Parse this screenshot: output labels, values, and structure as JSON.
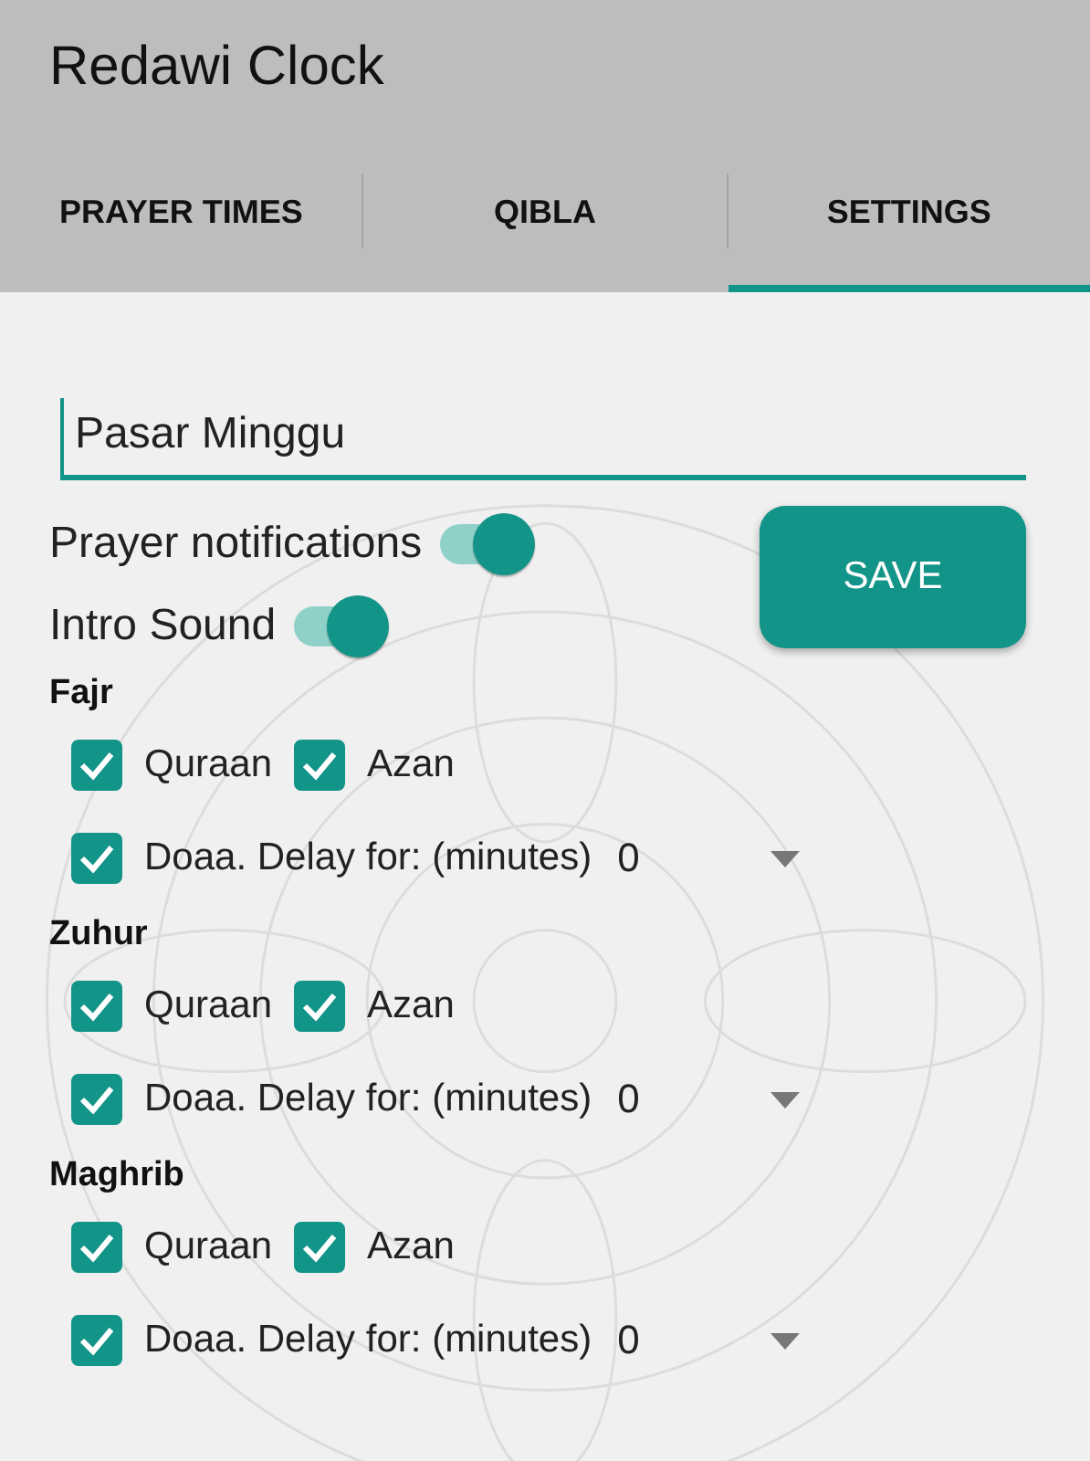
{
  "app_bar": {
    "title": "Redawi Clock"
  },
  "tabs": [
    {
      "label": "PRAYER TIMES",
      "selected": false
    },
    {
      "label": "QIBLA",
      "selected": false
    },
    {
      "label": "SETTINGS",
      "selected": true
    }
  ],
  "city": {
    "value": "Pasar Minggu"
  },
  "toggles": [
    {
      "label": "Prayer notifications",
      "on": true
    },
    {
      "label": "Intro Sound",
      "on": true
    }
  ],
  "save_button": "SAVE",
  "prayers": [
    {
      "name": "Fajr",
      "options": [
        {
          "label": "Quraan",
          "checked": true
        },
        {
          "label": "Azan",
          "checked": true
        }
      ],
      "doaa": {
        "label": "Doaa. Delay for: (minutes)",
        "checked": true
      },
      "delay": "0"
    },
    {
      "name": "Zuhur",
      "options": [
        {
          "label": "Quraan",
          "checked": true
        },
        {
          "label": "Azan",
          "checked": true
        }
      ],
      "doaa": {
        "label": "Doaa. Delay for: (minutes)",
        "checked": true
      },
      "delay": "0"
    },
    {
      "name": "Maghrib",
      "options": [
        {
          "label": "Quraan",
          "checked": true
        },
        {
          "label": "Azan",
          "checked": true
        }
      ],
      "doaa": {
        "label": "Doaa. Delay for: (minutes)",
        "checked": true
      },
      "delay": "0"
    }
  ]
}
